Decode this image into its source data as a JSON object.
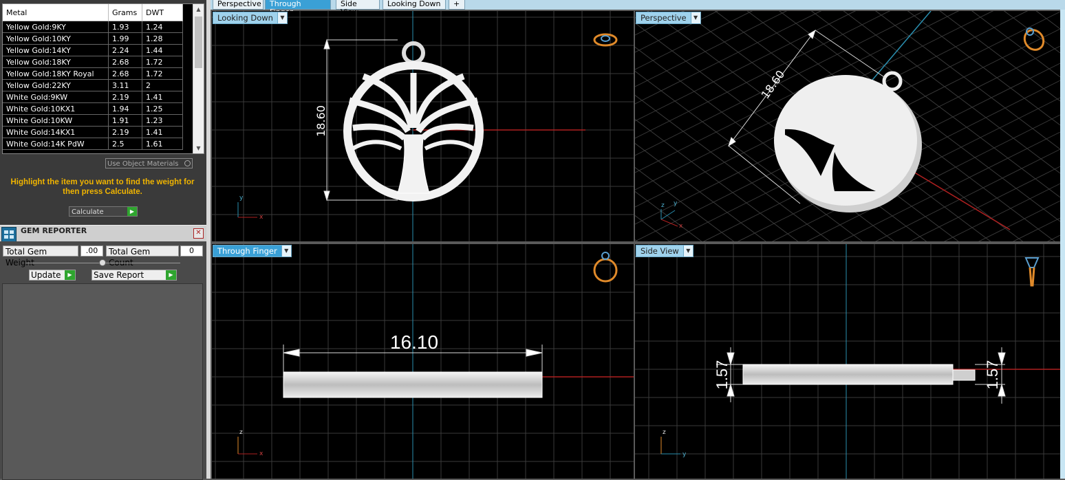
{
  "metal_table": {
    "headers": [
      "Metal",
      "Grams",
      "DWT"
    ],
    "rows": [
      [
        "Yellow Gold:9KY",
        "1.93",
        "1.24"
      ],
      [
        "Yellow Gold:10KY",
        "1.99",
        "1.28"
      ],
      [
        "Yellow Gold:14KY",
        "2.24",
        "1.44"
      ],
      [
        "Yellow Gold:18KY",
        "2.68",
        "1.72"
      ],
      [
        "Yellow Gold:18KY Royal",
        "2.68",
        "1.72"
      ],
      [
        "Yellow Gold:22KY",
        "3.11",
        "2"
      ],
      [
        "White Gold:9KW",
        "2.19",
        "1.41"
      ],
      [
        "White Gold:10KX1",
        "1.94",
        "1.25"
      ],
      [
        "White Gold:10KW",
        "1.91",
        "1.23"
      ],
      [
        "White Gold:14KX1",
        "2.19",
        "1.41"
      ],
      [
        "White Gold:14K PdW",
        "2.5",
        "1.61"
      ]
    ]
  },
  "use_object_materials": "Use Object Materials",
  "hint": "Highlight the item you want to find the weight for then press Calculate.",
  "calculate_label": "Calculate",
  "gem_reporter": {
    "title": "GEM REPORTER",
    "total_gem_weight_label": "Total Gem Weight",
    "total_gem_weight_value": ".00",
    "total_gem_count_label": "Total Gem Count",
    "total_gem_count_value": "0",
    "update_label": "Update",
    "save_report_label": "Save Report"
  },
  "tabs": [
    "Perspective",
    "Through Finger",
    "Side View",
    "Looking Down",
    "+"
  ],
  "active_tab": "Through Finger",
  "viewports": {
    "top_left": {
      "label": "Looking Down",
      "dimension": "18.60",
      "axes": [
        "y",
        "x"
      ]
    },
    "top_right": {
      "label": "Perspective",
      "dimension": "18.60",
      "axes": [
        "z",
        "y",
        "x"
      ]
    },
    "bottom_left": {
      "label": "Through Finger",
      "dimension": "16.10",
      "axes": [
        "z",
        "x"
      ]
    },
    "bottom_right": {
      "label": "Side View",
      "dimension_left": "1.57",
      "dimension_right": "1.57",
      "axes": [
        "z",
        "y"
      ]
    }
  },
  "colors": {
    "tab_active": "#3aa0d6",
    "hint_text": "#f0b400",
    "go_button": "#2fa52f",
    "axis_red": "#b02020",
    "axis_cyan": "#2a8fb0",
    "grid": "#3a3a3a",
    "viewport_bg": "#000000"
  },
  "icons": [
    "ring-top-view-icon",
    "ring-perspective-icon",
    "ring-front-icon",
    "ring-side-icon",
    "gem-reporter-icon",
    "close-icon",
    "chevron-down-icon",
    "play-arrow-icon"
  ]
}
